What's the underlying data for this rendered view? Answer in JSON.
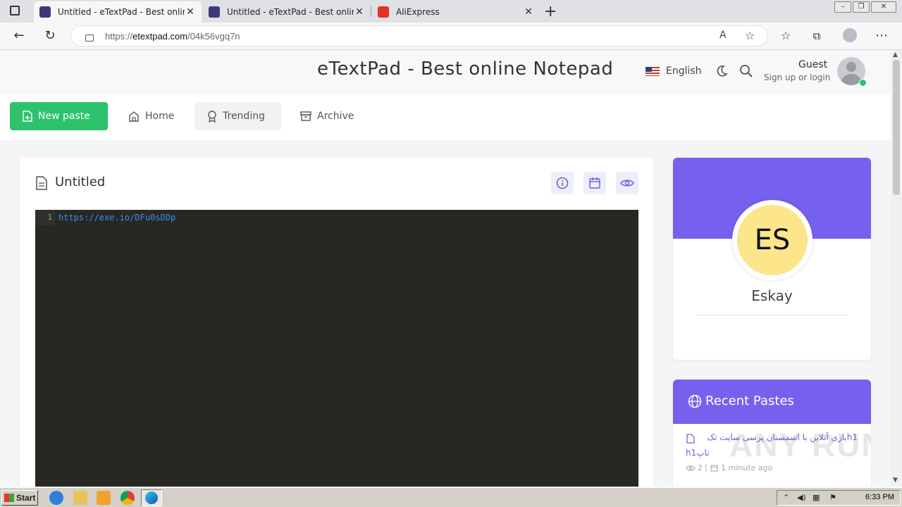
{
  "browser": {
    "tabs": [
      {
        "title": "Untitled - eTextPad - Best online N",
        "active": true
      },
      {
        "title": "Untitled - eTextPad - Best online N",
        "active": false
      },
      {
        "title": "AliExpress",
        "active": false
      }
    ],
    "url_prefix": "https://",
    "url_domain": "etextpad.com",
    "url_path": "/04k56vgq7n"
  },
  "header": {
    "site_title": "eTextPad - Best online Notepad",
    "language": "English",
    "user_name": "Guest",
    "user_sub": "Sign up or login"
  },
  "nav": {
    "new_paste": "New paste",
    "home": "Home",
    "trending": "Trending",
    "archive": "Archive"
  },
  "paste": {
    "title": "Untitled",
    "line_number": "1",
    "content": "https://exe.io/DFu0sDDp"
  },
  "profile": {
    "initials": "ES",
    "name": "Eskay",
    "accent": "#7561ee",
    "avatar_bg": "#fce58b"
  },
  "recent": {
    "heading": "Recent Pastes",
    "items": [
      {
        "title_line1": "h1بازی آنلاین با اسمستان پرسی سایت تک",
        "title_line2": "h1تاپ",
        "views": "2",
        "time": "1 minute ago"
      }
    ]
  },
  "watermark": "ANY RUN",
  "taskbar": {
    "start": "Start",
    "clock": "6:33 PM"
  }
}
